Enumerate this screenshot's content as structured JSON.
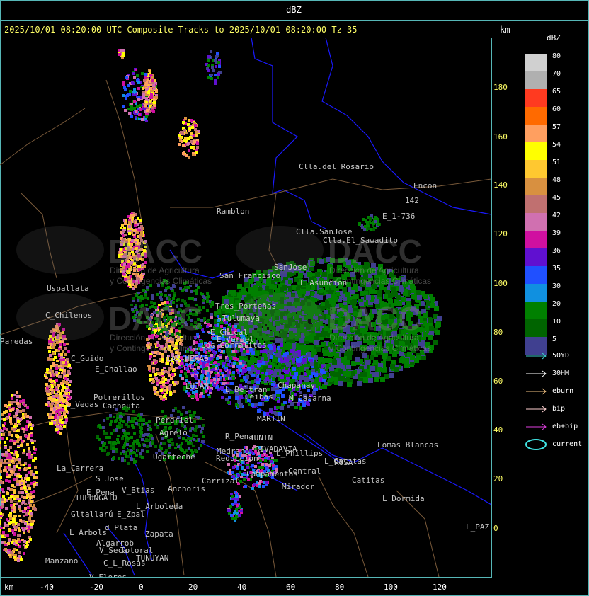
{
  "title_top": "dBZ",
  "header": "2025/10/01 08:20:00 UTC Composite Tracks to 2025/10/01 08:20:00 Tz 35",
  "km_label": "km",
  "y_axis_ticks": [
    "180",
    "160",
    "140",
    "120",
    "100",
    "80",
    "60",
    "40",
    "20",
    "0"
  ],
  "x_axis_ticks": [
    "-40",
    "-20",
    "0",
    "20",
    "40",
    "60",
    "80",
    "100",
    "120"
  ],
  "legend": {
    "title": "dBZ",
    "levels": [
      {
        "label": "80",
        "color": "#d0d0d0"
      },
      {
        "label": "70",
        "color": "#b0b0b0"
      },
      {
        "label": "65",
        "color": "#ff3a20"
      },
      {
        "label": "60",
        "color": "#ff6a00"
      },
      {
        "label": "57",
        "color": "#ff9f60"
      },
      {
        "label": "54",
        "color": "#ffff00"
      },
      {
        "label": "51",
        "color": "#ffc830"
      },
      {
        "label": "48",
        "color": "#d89040"
      },
      {
        "label": "45",
        "color": "#c07070"
      },
      {
        "label": "42",
        "color": "#d070b0"
      },
      {
        "label": "39",
        "color": "#d010a0"
      },
      {
        "label": "36",
        "color": "#6010d0"
      },
      {
        "label": "35",
        "color": "#2050ff"
      },
      {
        "label": "30",
        "color": "#1090e0"
      },
      {
        "label": "20",
        "color": "#008000"
      },
      {
        "label": "10",
        "color": "#006400"
      },
      {
        "label": "5",
        "color": "#404090"
      }
    ],
    "tracks": [
      {
        "label": "50YD",
        "color": "#40d0d0"
      },
      {
        "label": "30HM",
        "color": "#ffffff"
      },
      {
        "label": "eburn",
        "color": "#f0c080"
      },
      {
        "label": "bip",
        "color": "#ffd0d0"
      },
      {
        "label": "eb+bip",
        "color": "#e040e0"
      },
      {
        "label": "current",
        "color": "#40e0e0"
      }
    ]
  },
  "watermark": {
    "brand": "DACC",
    "subtitle_1": "Dirección de Agricultura",
    "subtitle_2": "y Contingencias Climáticas"
  },
  "places": [
    {
      "name": "Clla.del_Rosario"
    },
    {
      "name": "Encon"
    },
    {
      "name": "142"
    },
    {
      "name": "E_1-736"
    },
    {
      "name": "Ramblon"
    },
    {
      "name": "Clla.SanJose"
    },
    {
      "name": "Clla.El_Sawadito"
    },
    {
      "name": "Uspallata"
    },
    {
      "name": "San Francisco"
    },
    {
      "name": "SanJose"
    },
    {
      "name": "L_Asuncion"
    },
    {
      "name": "Tres_Porteñas"
    },
    {
      "name": "Tulumaya"
    },
    {
      "name": "C_Chilenos"
    },
    {
      "name": "E_Chical"
    },
    {
      "name": "E_Vergel"
    },
    {
      "name": "Paredas"
    },
    {
      "name": "C_Guido"
    },
    {
      "name": "E_Challao"
    },
    {
      "name": "LAS HERAS"
    },
    {
      "name": "Los Corralitos"
    },
    {
      "name": "L_Beltran"
    },
    {
      "name": "Ceibas"
    },
    {
      "name": "Chapanay"
    },
    {
      "name": "M_Casarna"
    },
    {
      "name": "Potrerillos"
    },
    {
      "name": "L_Vegas"
    },
    {
      "name": "Cacheuta"
    },
    {
      "name": "Perdriel"
    },
    {
      "name": "Agrelo"
    },
    {
      "name": "MARTIN"
    },
    {
      "name": "R_Pena"
    },
    {
      "name": "JUNIN"
    },
    {
      "name": "Medrano"
    },
    {
      "name": "RIVADAVIA"
    },
    {
      "name": "Reduccion"
    },
    {
      "name": "L_Phillips"
    },
    {
      "name": "Ugarteche"
    },
    {
      "name": "L_Catitas"
    },
    {
      "name": "Lomas_Blancas"
    },
    {
      "name": "La_Carrera"
    },
    {
      "name": "S_Jose"
    },
    {
      "name": "Carrizal"
    },
    {
      "name": "Campamentos"
    },
    {
      "name": "Central"
    },
    {
      "name": "ROSA"
    },
    {
      "name": "Catitas"
    },
    {
      "name": "E_Pena"
    },
    {
      "name": "TUPUNGATO"
    },
    {
      "name": "V_Btias"
    },
    {
      "name": "Anchoris"
    },
    {
      "name": "Mirador"
    },
    {
      "name": "L_Dormida"
    },
    {
      "name": "L_Arboleda"
    },
    {
      "name": "Gltallarú"
    },
    {
      "name": "E_Zpal"
    },
    {
      "name": "d_Plata"
    },
    {
      "name": "L_Arbols"
    },
    {
      "name": "Zapata"
    },
    {
      "name": "Algarrob"
    },
    {
      "name": "V_Seca"
    },
    {
      "name": "Totoral"
    },
    {
      "name": "TUNUYAN"
    },
    {
      "name": "C_L_Rosas"
    },
    {
      "name": "V_Flores"
    },
    {
      "name": "Manzano"
    },
    {
      "name": "L_PAZ"
    },
    {
      "name": "LUJAN"
    }
  ]
}
